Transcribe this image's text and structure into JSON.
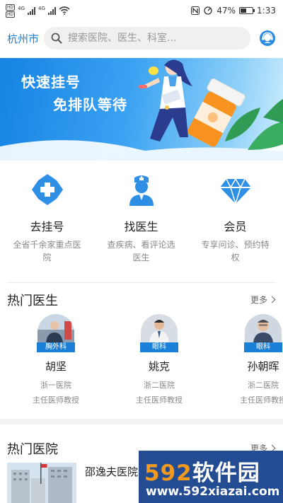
{
  "status_bar": {
    "hd_1": "HD",
    "hd_2": "HD",
    "net_1": "4G",
    "net_2": "4G",
    "battery_pct": "47%",
    "battery_level": 0.47,
    "time": "1:33"
  },
  "header": {
    "city": "杭州市",
    "search_placeholder": "搜索医院、医生、科室..."
  },
  "banner": {
    "line1": "快速挂号",
    "line2": "免排队等待"
  },
  "features": [
    {
      "title": "去挂号",
      "desc": "全省千余家重点医院",
      "icon": "hospital-cross-icon"
    },
    {
      "title": "找医生",
      "desc": "查疾病、看评论选医生",
      "icon": "doctor-icon"
    },
    {
      "title": "会员",
      "desc": "专享问诊、预约特权",
      "icon": "diamond-icon"
    }
  ],
  "hot_doctors": {
    "title": "热门医生",
    "more": "更多",
    "items": [
      {
        "dept": "胸外科",
        "name": "胡坚",
        "hospital": "浙一医院",
        "title": "主任医师教授"
      },
      {
        "dept": "眼科",
        "name": "姚克",
        "hospital": "浙二医院",
        "title": "主任医师教授"
      },
      {
        "dept": "眼科",
        "name": "孙朝晖",
        "hospital": "浙二医院",
        "title": "主任医师教授"
      }
    ]
  },
  "hot_hospitals": {
    "title": "热门医院",
    "more": "更多",
    "first_name": "邵逸夫医院"
  },
  "watermark": {
    "digits": "592",
    "brand": "软件园",
    "url": "www.592xiazai.com"
  },
  "colors": {
    "accent": "#1a7fd6",
    "banner_start": "#1683e3",
    "watermark_bg": "#234c93",
    "watermark_orange": "#f39a1e"
  }
}
